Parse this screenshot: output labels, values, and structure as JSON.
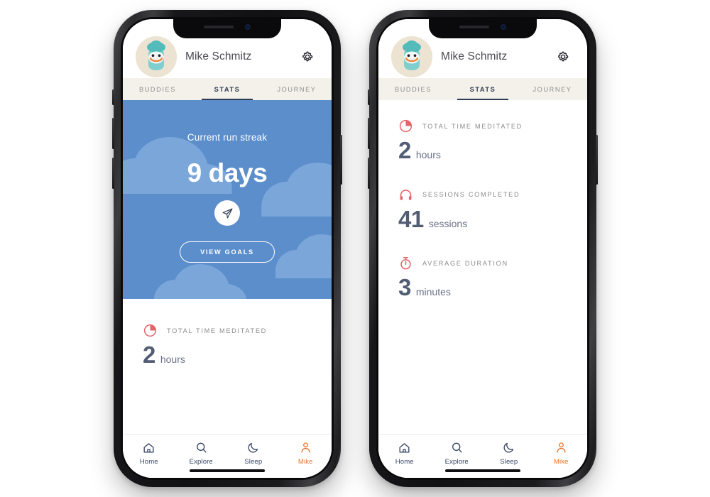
{
  "app": {
    "user_name": "Mike Schmitz",
    "gear_icon": "gear-icon",
    "avatar_icon": "avatar-monster-icon",
    "accent_orange": "#f0722c",
    "accent_coral": "#e8646b",
    "hero_blue": "#5b8ecb",
    "cloud_blue": "#7aa6da",
    "tabbar_bg": "#f3f1e9",
    "navy": "#2f3b55",
    "stat_num_color": "#525d73"
  },
  "tabs": [
    {
      "label": "BUDDIES",
      "active": false
    },
    {
      "label": "STATS",
      "active": true
    },
    {
      "label": "JOURNEY",
      "active": false
    }
  ],
  "hero": {
    "label": "Current run streak",
    "value": "9 days",
    "send_icon": "paper-plane-icon",
    "button_label": "VIEW GOALS"
  },
  "stats": [
    {
      "icon": "pie-chart-icon",
      "title": "TOTAL TIME MEDITATED",
      "number": "2",
      "unit": "hours"
    },
    {
      "icon": "headphones-icon",
      "title": "SESSIONS COMPLETED",
      "number": "41",
      "unit": "sessions"
    },
    {
      "icon": "stopwatch-icon",
      "title": "AVERAGE DURATION",
      "number": "3",
      "unit": "minutes"
    }
  ],
  "bottom_nav": [
    {
      "label": "Home",
      "icon": "home-icon",
      "active": false
    },
    {
      "label": "Explore",
      "icon": "search-icon",
      "active": false
    },
    {
      "label": "Sleep",
      "icon": "moon-icon",
      "active": false
    },
    {
      "label": "Mike",
      "icon": "person-icon",
      "active": true
    }
  ]
}
